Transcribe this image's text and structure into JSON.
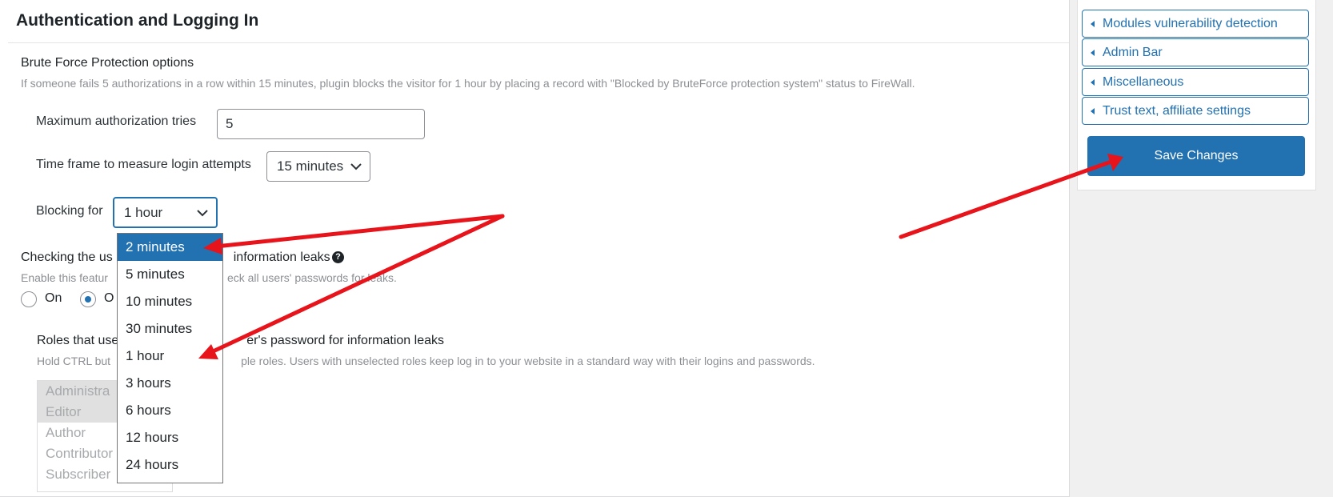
{
  "section": {
    "title": "Authentication and Logging In"
  },
  "brute_force": {
    "title": "Brute Force Protection options",
    "description": "If someone fails 5 authorizations in a row within 15 minutes, plugin blocks the visitor for 1 hour by placing a record with \"Blocked by BruteForce protection system\" status to FireWall.",
    "max_tries_label": "Maximum authorization tries",
    "max_tries_value": "5",
    "time_frame_label": "Time frame to measure login attempts",
    "time_frame_value": "15 minutes",
    "blocking_label": "Blocking for",
    "blocking_value": "1 hour",
    "blocking_options": [
      "2 minutes",
      "5 minutes",
      "10 minutes",
      "30 minutes",
      "1 hour",
      "3 hours",
      "6 hours",
      "12 hours",
      "24 hours"
    ],
    "highlighted_option": "2 minutes"
  },
  "password_leaks": {
    "title_start": "Checking the us",
    "title_end": "information leaks",
    "description_start": "Enable this featur",
    "description_end": "eck all users' passwords for leaks.",
    "radio_on_label": "On",
    "radio_off_label_partial": "O",
    "selected": "Off"
  },
  "roles": {
    "title_start": "Roles that use",
    "title_end": "er's password for information leaks",
    "description_start": "Hold CTRL but",
    "description_end": "ple roles. Users with unselected roles keep log in to your website in a standard way with their logins and passwords.",
    "items": [
      {
        "label": "Administra",
        "selected": true
      },
      {
        "label": "Editor",
        "selected": true
      },
      {
        "label": "Author",
        "selected": false
      },
      {
        "label": "Contributor",
        "selected": false
      },
      {
        "label": "Subscriber",
        "selected": false
      }
    ]
  },
  "sidebar": {
    "items": [
      {
        "label": "Modules vulnerability detection"
      },
      {
        "label": "Admin Bar"
      },
      {
        "label": "Miscellaneous"
      },
      {
        "label": "Trust text, affiliate settings"
      }
    ],
    "save_label": "Save Changes"
  },
  "colors": {
    "accent": "#2271b1",
    "annotation_arrow": "#e8141b"
  }
}
